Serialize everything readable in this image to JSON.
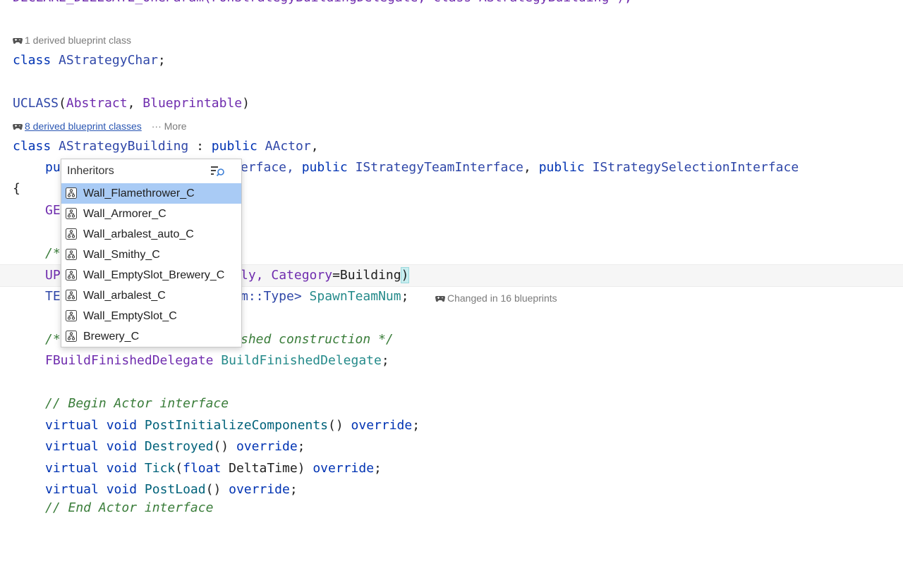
{
  "hints": {
    "astrategychar": "1 derived blueprint class",
    "astrategybuilding_link": "8 derived blueprint classes",
    "more": "··· More",
    "spawnteamnum": "Changed in 16 blueprints"
  },
  "code": {
    "line_top": "DECLARE_DELEGATE_OneParam(FOnStrategyBuildingDelegate, class AStrategyBuilding*);",
    "l1_kw": "class",
    "l1_name": "AStrategyChar",
    "l1_semi": ";",
    "l2_mac": "UCLASS",
    "l2_open": "(",
    "l2_a": "Abstract",
    "l2_comma": ", ",
    "l2_b": "Blueprintable",
    "l2_close": ")",
    "l3_kw": "class",
    "l3_name": "AStrategyBuilding",
    "l3_colon": " : ",
    "l3_pub": "public",
    "l3_base": "AActor",
    "l3_comma": ",",
    "l4_a": "pu",
    "l4_b": "erface, ",
    "l4_pub1": "public",
    "l4_i1": "IStrategyTeamInterface",
    "l4_c": ", ",
    "l4_pub2": "public",
    "l4_i2": "IStrategySelectionInterface",
    "l5": "{",
    "l6": "GE",
    "l7": "/*",
    "l8_a": "UP",
    "l8_b": "ly, ",
    "l8_cat": "Category",
    "l8_eq": "=Building",
    "l8_close": ")",
    "l9_a": "TE",
    "l9_b": "m::Type> ",
    "l9_field": "SpawnTeamNum",
    "l9_semi": ";",
    "l10_a": "/*",
    "l10_b": "shed construction */",
    "l11_type": "FBuildFinishedDelegate",
    "l11_field": "BuildFinishedDelegate",
    "l11_semi": ";",
    "l12": "// Begin Actor interface",
    "l13_v": "virtual",
    "l13_t": "void",
    "l13_fn": "PostInitializeComponents",
    "l13_p": "() ",
    "l13_o": "override",
    "l13_s": ";",
    "l14_v": "virtual",
    "l14_t": "void",
    "l14_fn": "Destroyed",
    "l14_p": "() ",
    "l14_o": "override",
    "l14_s": ";",
    "l15_v": "virtual",
    "l15_t": "void",
    "l15_fn": "Tick",
    "l15_p1": "(",
    "l15_ft": "float",
    "l15_arg": " DeltaTime) ",
    "l15_o": "override",
    "l15_s": ";",
    "l16_v": "virtual",
    "l16_t": "void",
    "l16_fn": "PostLoad",
    "l16_p": "() ",
    "l16_o": "override",
    "l16_s": ";",
    "l17": "// End Actor interface"
  },
  "popup": {
    "title": "Inheritors",
    "items": [
      {
        "label": "Wall_Flamethrower_C"
      },
      {
        "label": "Wall_Armorer_C"
      },
      {
        "label": "Wall_arbalest_auto_C"
      },
      {
        "label": "Wall_Smithy_C"
      },
      {
        "label": "Wall_EmptySlot_Brewery_C"
      },
      {
        "label": "Wall_arbalest_C"
      },
      {
        "label": "Wall_EmptySlot_C"
      },
      {
        "label": "Brewery_C"
      }
    ],
    "selected_index": 0
  },
  "colors": {
    "keyword": "#0033b3",
    "macro": "#6f2cae",
    "function": "#00627a",
    "field": "#248a8a",
    "comment": "#3a7d3a",
    "selection": "#a9cbf5"
  }
}
